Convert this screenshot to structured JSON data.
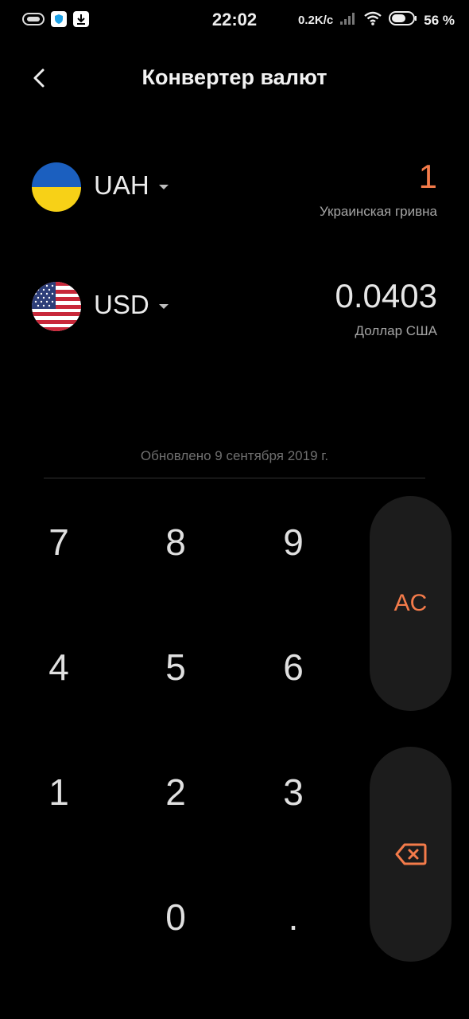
{
  "status_bar": {
    "time": "22:02",
    "net_speed": "0.2K/с",
    "battery_percent": "56 %",
    "icons": [
      "messages-icon",
      "shield-icon",
      "download-icon",
      "signal-icon",
      "wifi-icon",
      "battery-icon"
    ]
  },
  "header": {
    "title": "Конвертер валют"
  },
  "currencies": [
    {
      "code": "UAH",
      "value": "1",
      "name": "Украинская гривна",
      "flag": "ukraine-flag"
    },
    {
      "code": "USD",
      "value": "0.0403",
      "name": "Доллар США",
      "flag": "usa-flag"
    }
  ],
  "updated_text": "Обновлено 9 сентября 2019 г.",
  "keypad": {
    "keys": [
      "7",
      "8",
      "9",
      "4",
      "5",
      "6",
      "1",
      "2",
      "3",
      "0",
      "."
    ],
    "clear_label": "AC"
  },
  "colors": {
    "accent": "#f47b4a",
    "background": "#000000",
    "side_button_bg": "#1c1c1c"
  }
}
